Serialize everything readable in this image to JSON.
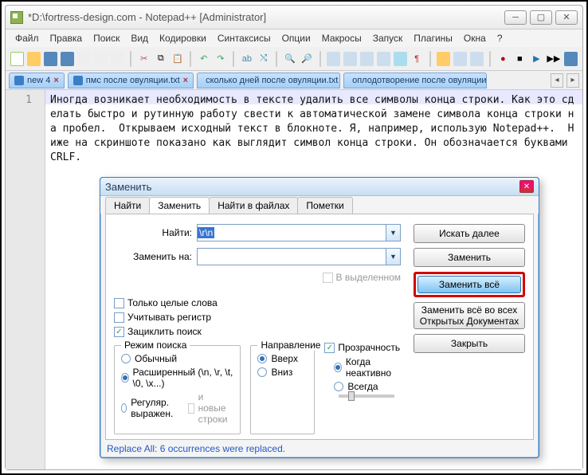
{
  "title": "*D:\\fortress-design.com - Notepad++ [Administrator]",
  "menus": [
    "Файл",
    "Правка",
    "Поиск",
    "Вид",
    "Кодировки",
    "Синтаксисы",
    "Опции",
    "Макросы",
    "Запуск",
    "Плагины",
    "Окна",
    "?"
  ],
  "doctabs": [
    {
      "label": "new 4"
    },
    {
      "label": "пмс после овуляции.txt"
    },
    {
      "label": "сколько дней после овуляции.txt"
    },
    {
      "label": "оплодотворение после овуляции.txt"
    }
  ],
  "line_no": "1",
  "editor_text": "Иногда возникает необходимость в тексте удалить все символы конца строки. Как это сделать быстро и рутинную работу свести к автоматической замене символа конца строки на пробел.  Открываем исходный текст в блокноте. Я, например, использую Notepad++.  Ниже на скриншоте показано как выглядит символ конца строки. Он обозначается буквами CRLF.",
  "dialog": {
    "title": "Заменить",
    "tabs": [
      "Найти",
      "Заменить",
      "Найти в файлах",
      "Пометки"
    ],
    "active_tab": 1,
    "find_label": "Найти:",
    "find_value": "\\r\\n",
    "replace_label": "Заменить на:",
    "replace_value": "",
    "in_selection": "В выделенном",
    "buttons": {
      "find_next": "Искать далее",
      "replace": "Заменить",
      "replace_all": "Заменить всё",
      "replace_all_docs": "Заменить всё во всех Открытых Документах",
      "close": "Закрыть"
    },
    "checks": {
      "whole_words": "Только целые слова",
      "match_case": "Учитывать регистр",
      "wrap": "Зациклить поиск"
    },
    "mode": {
      "legend": "Режим поиска",
      "normal": "Обычный",
      "extended": "Расширенный (\\n, \\r, \\t, \\0, \\x...)",
      "regex": "Регуляр. выражен.",
      "newlines": "и новые строки"
    },
    "direction": {
      "legend": "Направление",
      "up": "Вверх",
      "down": "Вниз"
    },
    "transparency": {
      "label": "Прозрачность",
      "inactive": "Когда неактивно",
      "always": "Всегда"
    },
    "status": "Replace All: 6 occurrences were replaced."
  }
}
